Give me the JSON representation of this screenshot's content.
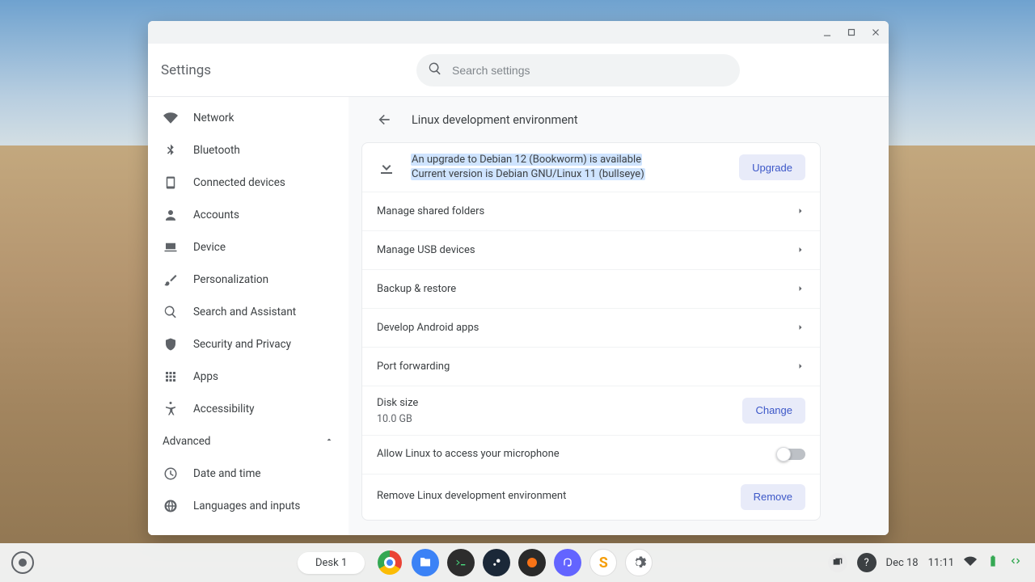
{
  "header": {
    "title": "Settings",
    "search_placeholder": "Search settings"
  },
  "sidebar": {
    "items": [
      {
        "label": "Network"
      },
      {
        "label": "Bluetooth"
      },
      {
        "label": "Connected devices"
      },
      {
        "label": "Accounts"
      },
      {
        "label": "Device"
      },
      {
        "label": "Personalization"
      },
      {
        "label": "Search and Assistant"
      },
      {
        "label": "Security and Privacy"
      },
      {
        "label": "Apps"
      },
      {
        "label": "Accessibility"
      }
    ],
    "advanced_label": "Advanced",
    "advanced_items": [
      {
        "label": "Date and time"
      },
      {
        "label": "Languages and inputs"
      }
    ]
  },
  "page": {
    "title": "Linux development environment",
    "upgrade": {
      "line1": "An upgrade to Debian 12 (Bookworm) is available",
      "line2": "Current version is Debian GNU/Linux 11 (bullseye)",
      "button": "Upgrade"
    },
    "rows": {
      "shared_folders": "Manage shared folders",
      "usb": "Manage USB devices",
      "backup": "Backup & restore",
      "android": "Develop Android apps",
      "port": "Port forwarding"
    },
    "disk": {
      "title": "Disk size",
      "value": "10.0 GB",
      "button": "Change"
    },
    "mic": {
      "label": "Allow Linux to access your microphone",
      "on": false
    },
    "remove": {
      "label": "Remove Linux development environment",
      "button": "Remove"
    }
  },
  "shelf": {
    "desk": "Desk 1",
    "date": "Dec 18",
    "time": "11:11"
  }
}
